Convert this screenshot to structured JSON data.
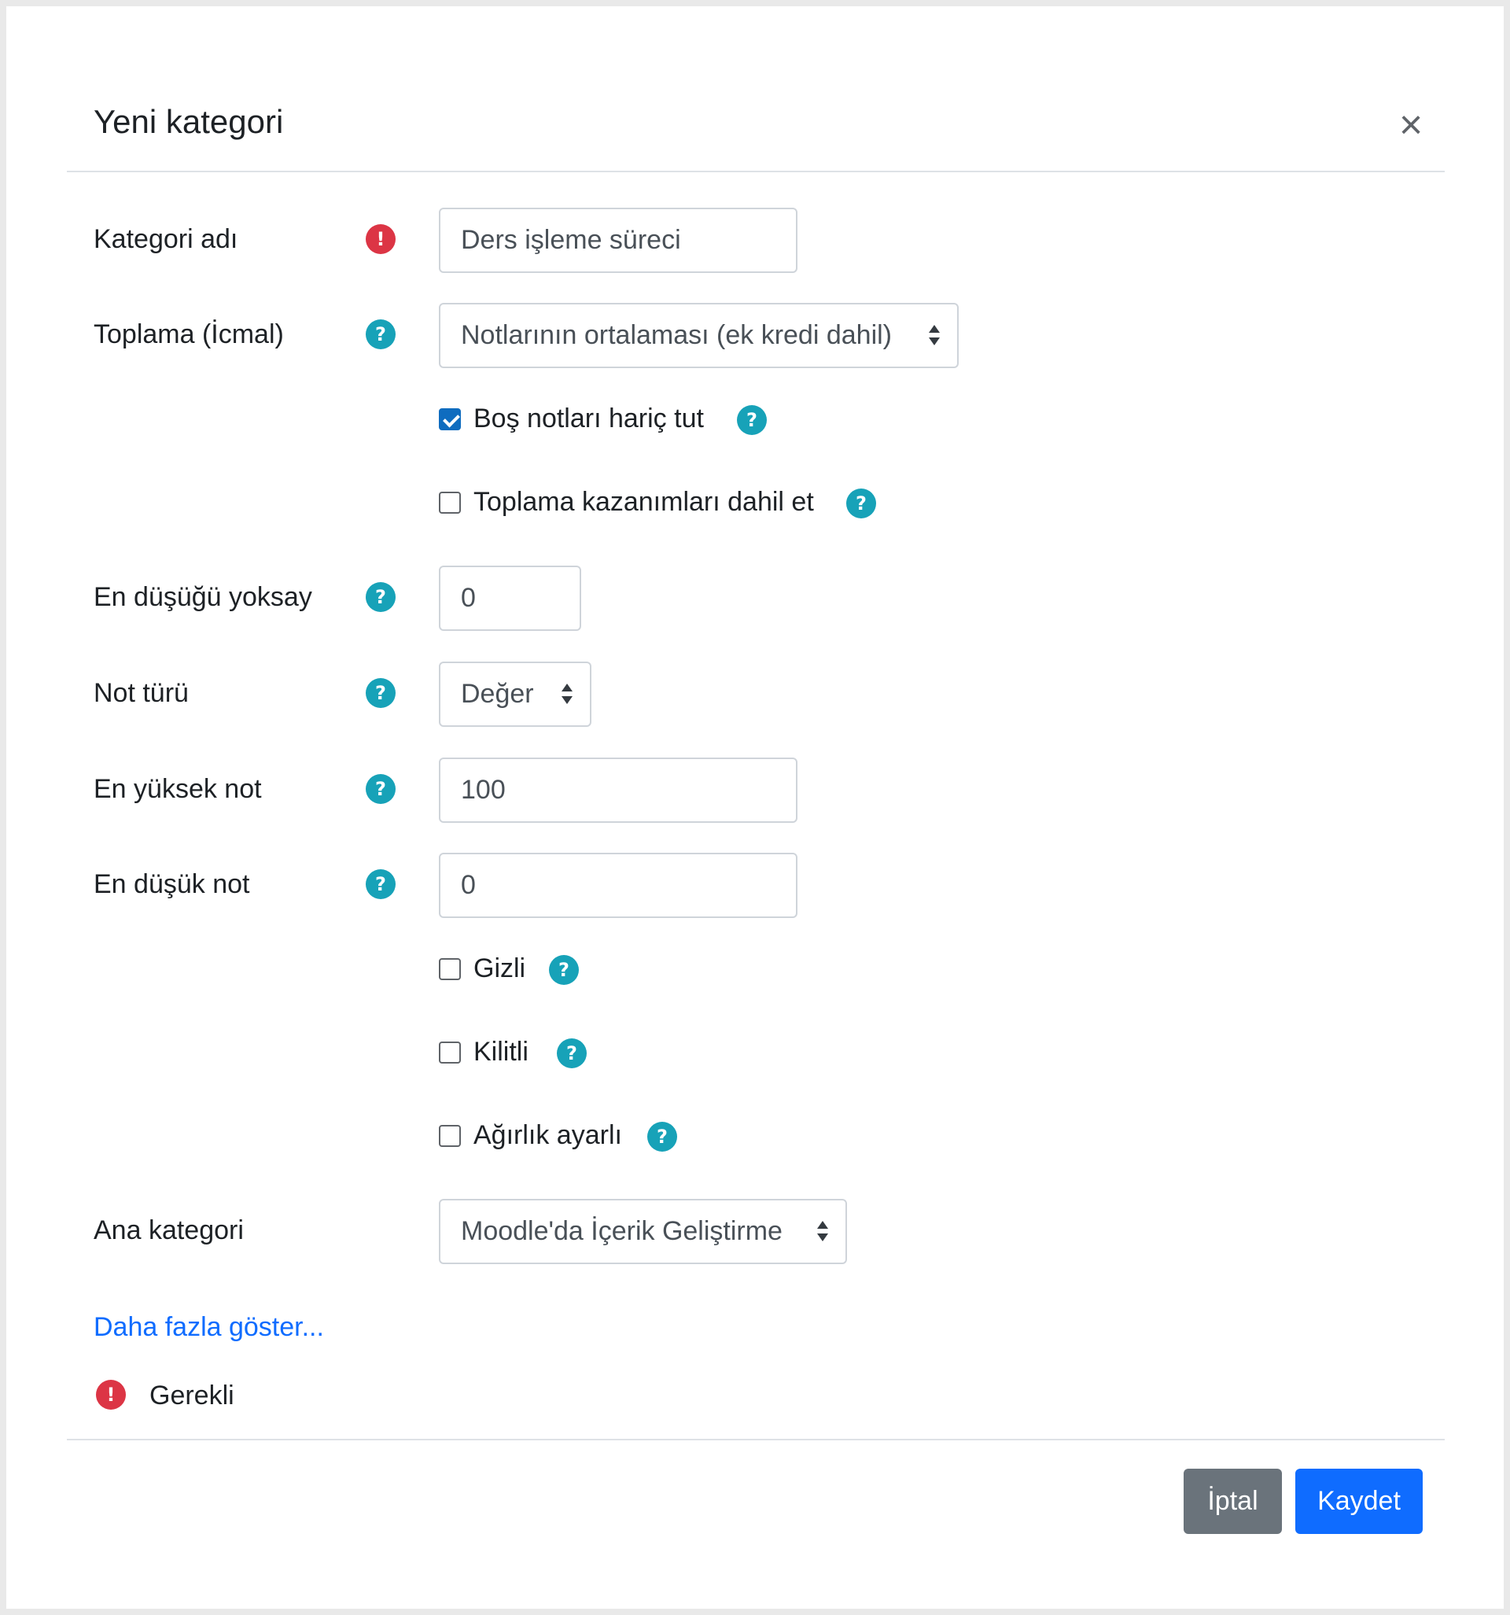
{
  "dialog": {
    "title": "Yeni kategori",
    "close_glyph": "×"
  },
  "fields": {
    "category_name": {
      "label": "Kategori adı",
      "value": "Ders işleme süreci"
    },
    "aggregation": {
      "label": "Toplama (İcmal)",
      "value": "Notlarının ortalaması (ek kredi dahil)"
    },
    "exclude_empty": {
      "label": "Boş notları hariç tut",
      "checked": true
    },
    "include_outcomes": {
      "label": "Toplama kazanımları dahil et",
      "checked": false
    },
    "drop_lowest": {
      "label": "En düşüğü yoksay",
      "value": "0"
    },
    "grade_type": {
      "label": "Not türü",
      "value": "Değer"
    },
    "max_grade": {
      "label": "En yüksek not",
      "value": "100"
    },
    "min_grade": {
      "label": "En düşük not",
      "value": "0"
    },
    "hidden": {
      "label": "Gizli",
      "checked": false
    },
    "locked": {
      "label": "Kilitli",
      "checked": false
    },
    "weight_adjusted": {
      "label": "Ağırlık ayarlı",
      "checked": false
    },
    "parent_category": {
      "label": "Ana kategori",
      "value": "Moodle'da İçerik Geliştirme"
    }
  },
  "show_more": "Daha fazla göster...",
  "required_note": "Gerekli",
  "icons": {
    "help": "?",
    "required": "!"
  },
  "buttons": {
    "cancel": "İptal",
    "save": "Kaydet"
  },
  "colors": {
    "primary": "#0f6cff",
    "help": "#17a2b8",
    "required": "#dc3545",
    "secondary": "#6a737b"
  }
}
